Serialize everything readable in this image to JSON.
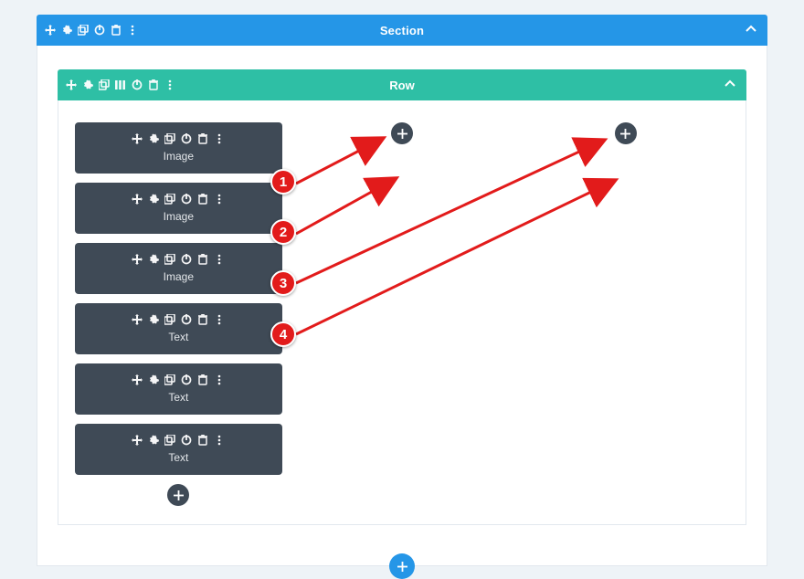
{
  "section": {
    "title": "Section",
    "toolsAria": {
      "move": "Move",
      "settings": "Settings",
      "duplicate": "Duplicate",
      "power": "Toggle",
      "trash": "Delete",
      "more": "More"
    },
    "addSectionLabel": "+"
  },
  "row": {
    "title": "Row",
    "toolsAria": {
      "move": "Move",
      "settings": "Settings",
      "duplicate": "Duplicate",
      "columns": "Change Columns",
      "power": "Toggle",
      "trash": "Delete",
      "more": "More"
    },
    "addRowLabel": "+"
  },
  "columns": [
    {
      "modules": [
        {
          "label": "Image"
        },
        {
          "label": "Image"
        },
        {
          "label": "Image"
        },
        {
          "label": "Text"
        },
        {
          "label": "Text"
        },
        {
          "label": "Text"
        }
      ],
      "addModuleLabel": "+"
    },
    {
      "modules": [],
      "addModuleLabel": "+"
    },
    {
      "modules": [],
      "addModuleLabel": "+"
    }
  ],
  "moduleTools": {
    "move": "Move",
    "settings": "Settings",
    "duplicate": "Duplicate",
    "power": "Toggle",
    "trash": "Delete",
    "more": "More"
  },
  "annotations": {
    "badges": [
      {
        "n": "1"
      },
      {
        "n": "2"
      },
      {
        "n": "3"
      },
      {
        "n": "4"
      }
    ]
  }
}
